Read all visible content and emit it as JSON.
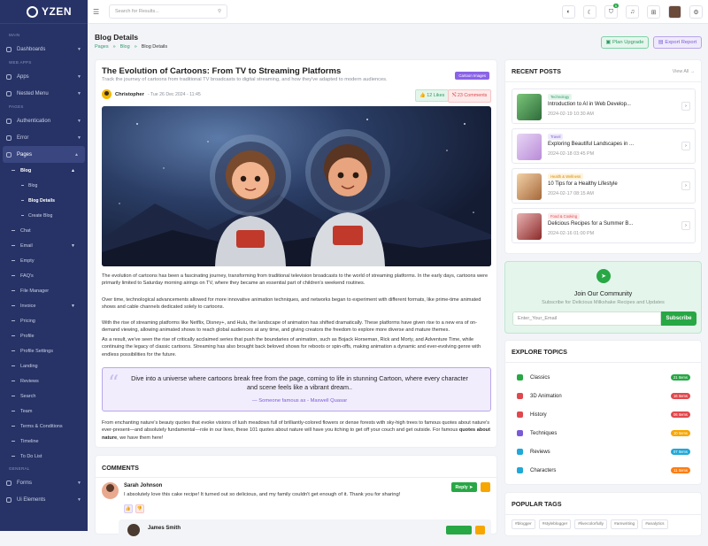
{
  "app": {
    "name": "YZEN"
  },
  "search": {
    "placeholder": "Search for Results..."
  },
  "sidebar": {
    "sections": {
      "main": "MAIN",
      "web_apps": "WEB APPS",
      "pages": "PAGES",
      "general": "GENERAL"
    },
    "items": {
      "dashboards": "Dashboards",
      "apps": "Apps",
      "nested_menu": "Nested Menu",
      "authentication": "Authentication",
      "error": "Error",
      "pages": "Pages",
      "blog": "Blog",
      "blog_list": "Blog",
      "blog_details": "Blog Details",
      "create_blog": "Create Blog",
      "chat": "Chat",
      "email": "Email",
      "empty": "Empty",
      "faqs": "FAQ's",
      "file_manager": "File Manager",
      "invoice": "Invoice",
      "pricing": "Pricing",
      "profile": "Profile",
      "profile_settings": "Profile Settings",
      "landing": "Landing",
      "reviews": "Reviews",
      "search": "Search",
      "team": "Team",
      "terms": "Terms & Conditions",
      "timeline": "Timeline",
      "todo": "To Do List",
      "forms": "Forms",
      "ui_elements": "Ui Elements"
    }
  },
  "topbar": {
    "cart_count": "5"
  },
  "page": {
    "title": "Blog Details",
    "breadcrumb": [
      "Pages",
      "Blog",
      "Blog Details"
    ],
    "plan_upgrade": "Plan Upgrade",
    "export_report": "Export Report"
  },
  "article": {
    "title": "The Evolution of Cartoons: From TV to Streaming Platforms",
    "subtitle": "Track the journey of cartoons from traditional TV broadcasts to digital streaming, and how they've adapted to modern audiences.",
    "category": "Cartoon Images",
    "author": "Christopher",
    "date": "- Tue 26 Dec 2024 - 11:45",
    "likes": "12 Likes",
    "comments": "23 Comments",
    "p1": "The evolution of cartoons has been a fascinating journey, transforming from traditional television broadcasts to the world of streaming platforms. In the early days, cartoons were primarily limited to Saturday morning airings on TV, where they became an essential part of children's weekend routines.",
    "p2": "Over time, technological advancements allowed for more innovative animation techniques, and networks began to experiment with different formats, like prime-time animated shows and cable channels dedicated solely to cartoons.",
    "p3": "With the rise of streaming platforms like Netflix, Disney+, and Hulu, the landscape of animation has shifted dramatically. These platforms have given rise to a new era of on-demand viewing, allowing animated shows to reach global audiences at any time, and giving creators the freedom to explore more diverse and mature themes.",
    "p4": "As a result, we've seen the rise of critically acclaimed series that push the boundaries of animation, such as Bojack Horseman, Rick and Morty, and Adventure Time, while continuing the legacy of classic cartoons. Streaming has also brought back beloved shows for reboots or spin-offs, making animation a dynamic and ever-evolving genre with endless possibilities for the future.",
    "quote": "Dive into a universe where cartoons break free from the page, coming to life in stunning Cartoon, where every character and scene feels like a vibrant dream..",
    "quote_author": "— Someone famous as - Maxwell Quasar",
    "p5_start": "From enchanting nature's beauty quotes that evoke visions of lush meadows full of brilliantly-colored flowers or dense forests with sky-high trees to famous quotes about nature's ever-present—and absolutely fundamental—role in our lives, these 101 quotes about nature will have you itching to get off your couch and get outside. For famous ",
    "p5_bold": "quotes about nature",
    "p5_end": ", we have them here!"
  },
  "comments": {
    "heading": "COMMENTS",
    "items": [
      {
        "name": "Sarah Johnson",
        "text": "I absolutely love this cake recipe! It turned out so delicious, and my family couldn't get enough of it. Thank you for sharing!",
        "reply": "Reply"
      },
      {
        "name": "James Smith",
        "reply": "Reply"
      }
    ]
  },
  "recent_posts": {
    "heading": "RECENT POSTS",
    "view_all": "View All",
    "items": [
      {
        "category": "Technology",
        "title": "Introduction to AI in Web Develop...",
        "date": "2024-02-19 10:30 AM",
        "cat_bg": "#e4f5ec",
        "cat_fg": "#2c9b63"
      },
      {
        "category": "Travel",
        "title": "Exploring Beautiful Landscapes in ...",
        "date": "2024-02-18 03:45 PM",
        "cat_bg": "#efeafb",
        "cat_fg": "#7a5bd6"
      },
      {
        "category": "Health & Wellness",
        "title": "10 Tips for a Healthy Lifestyle",
        "date": "2024-02-17 08:15 AM",
        "cat_bg": "#fff3dc",
        "cat_fg": "#d48a00"
      },
      {
        "category": "Food & Cooking",
        "title": "Delicious Recipes for a Summer B...",
        "date": "2024-02-16 01:00 PM",
        "cat_bg": "#fdeaea",
        "cat_fg": "#e0484d"
      }
    ]
  },
  "community": {
    "title": "Join Our Community",
    "subtitle": "Subscribe for Delicious Milkshake Recipes and Updates",
    "placeholder": "Enter_Your_Email",
    "button": "Subscribe"
  },
  "topics": {
    "heading": "EXPLORE TOPICS",
    "items": [
      {
        "label": "Classics",
        "count": "21 Items",
        "color": "#28a745"
      },
      {
        "label": "3D Animation",
        "count": "16 Items",
        "color": "#e0484d"
      },
      {
        "label": "History",
        "count": "06 Items",
        "color": "#e0484d"
      },
      {
        "label": "Techniques",
        "count": "10 Items",
        "color": "#f7a600"
      },
      {
        "label": "Reviews",
        "count": "07 Items",
        "color": "#20a8d8"
      },
      {
        "label": "Characters",
        "count": "11 Items",
        "color": "#fd7e14"
      }
    ]
  },
  "tags": {
    "heading": "POPULAR TAGS",
    "items": [
      "#blogger",
      "#styleblogger",
      "#livecolorfully",
      "#amwriting",
      "#analytics"
    ]
  }
}
